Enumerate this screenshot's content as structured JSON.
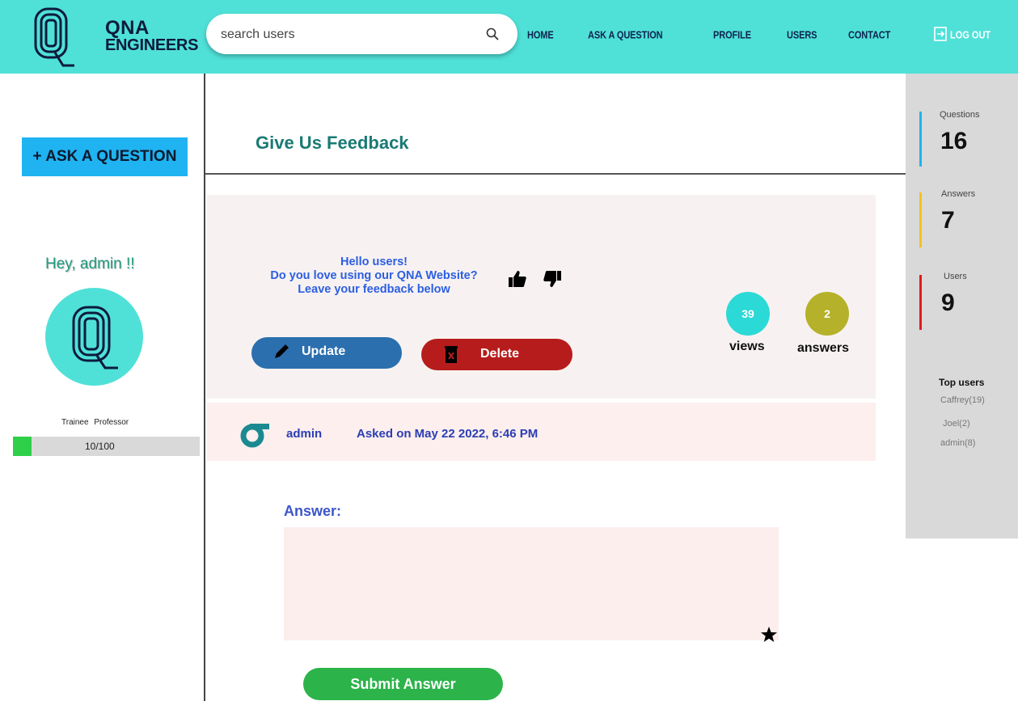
{
  "header": {
    "brand_line1": "QNA",
    "brand_line2": "ENGINEERS",
    "search_placeholder": "search users",
    "nav": [
      "HOME",
      "ASK A QUESTION",
      "PROFILE",
      "USERS",
      "CONTACT"
    ],
    "logout_label": "LOG OUT",
    "bg_color": "#4fe1d8"
  },
  "left_sidebar": {
    "ask_button": "+ ASK A QUESTION",
    "greeting": "Hey, admin !!",
    "rank_labels": "Trainee Professor",
    "progress_text": "10/100",
    "progress_fraction": 0.1
  },
  "main": {
    "page_title": "Give Us Feedback",
    "question": {
      "line1": "Hello users!",
      "line2": "Do you love using our QNA Website?",
      "line3": "Leave your feedback below",
      "update_label": "Update",
      "delete_label": "Delete",
      "views_count": "39",
      "views_label": "views",
      "answers_count": "2",
      "answers_label": "answers"
    },
    "meta": {
      "author": "admin",
      "asked": "Asked on May 22 2022, 6:46 PM"
    },
    "answer_label": "Answer:",
    "submit_label": "Submit Answer"
  },
  "right_sidebar": {
    "stats": [
      {
        "label": "Questions",
        "value": "16",
        "color": "#1fb3f1"
      },
      {
        "label": "Answers",
        "value": "7",
        "color": "#f4c21a"
      },
      {
        "label": "Users",
        "value": "9",
        "color": "#e21b1b"
      }
    ],
    "top_users_title": "Top users",
    "top_users": [
      "Caffrey(19)",
      "Joel(2)",
      "admin(8)"
    ]
  }
}
